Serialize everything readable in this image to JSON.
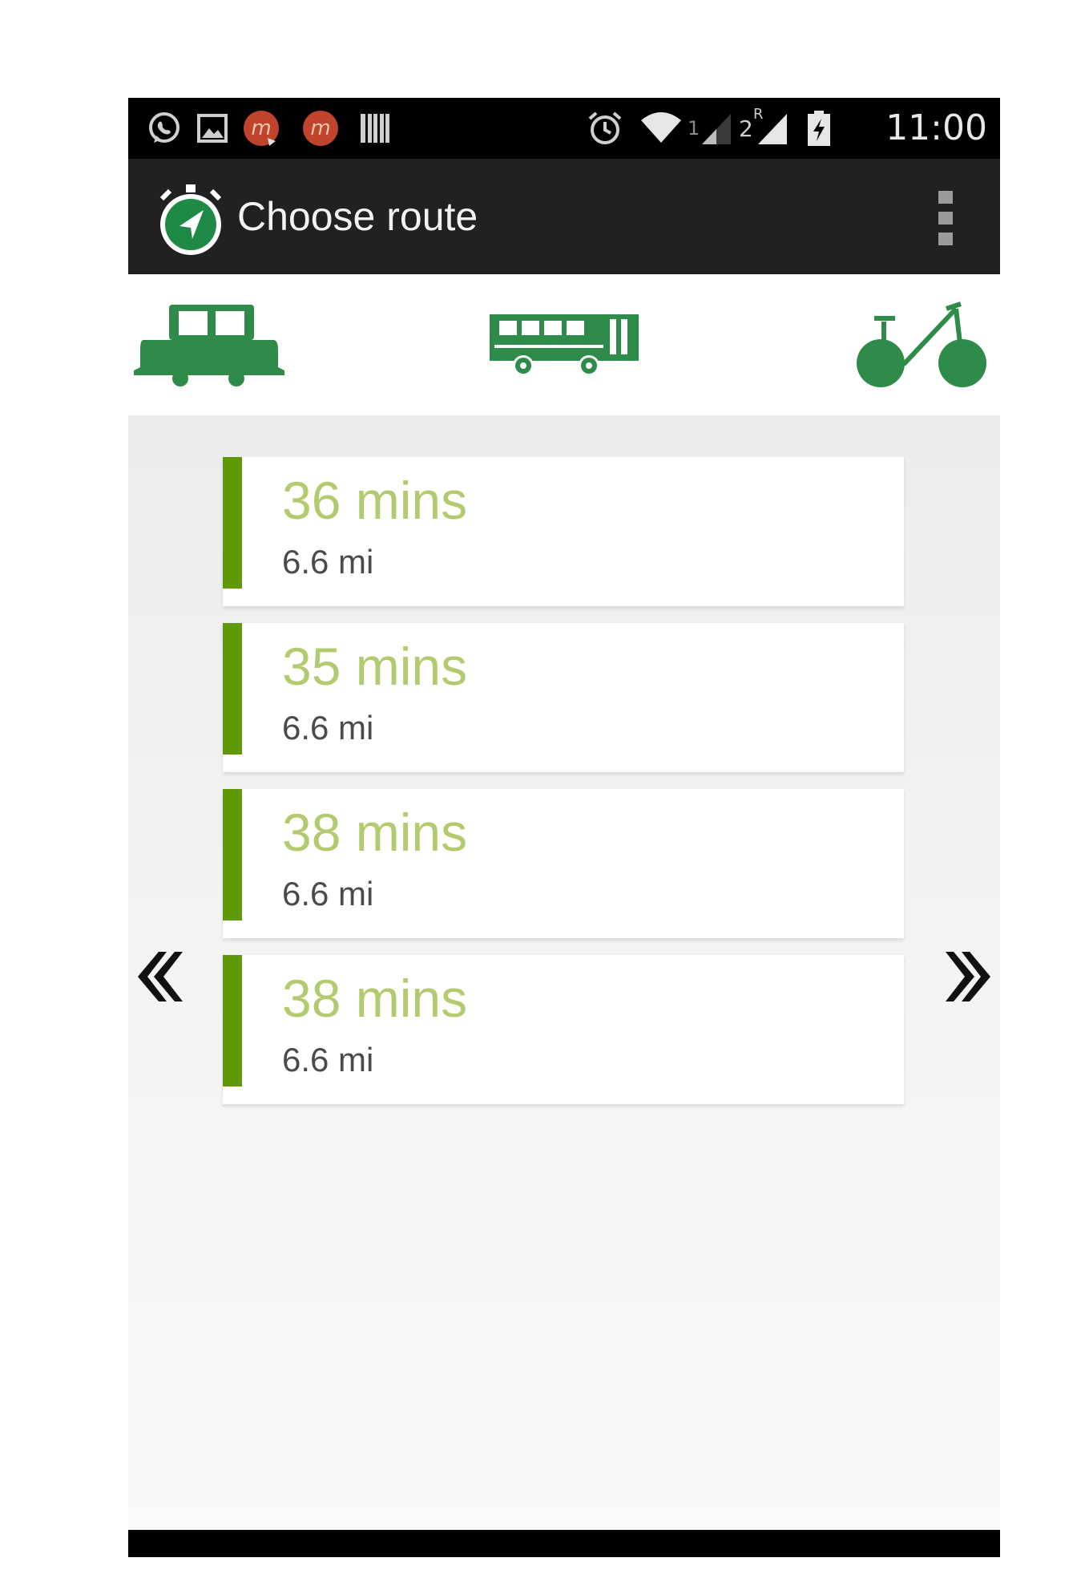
{
  "status_bar": {
    "time": "11:00",
    "sim1_label": "1",
    "sim2_label": "2",
    "roaming_label": "R",
    "left_icons": [
      "whatsapp-icon",
      "image-icon",
      "app-m-icon",
      "app-m-icon",
      "barcode-icon"
    ],
    "right_icons": [
      "alarm-icon",
      "wifi-icon",
      "signal-icon",
      "signal-icon",
      "battery-charging-icon"
    ]
  },
  "action_bar": {
    "title": "Choose route",
    "app_icon": "stopwatch-navigation-icon",
    "menu_icon": "overflow-menu-icon"
  },
  "modes": [
    {
      "name": "car",
      "icon": "car-icon"
    },
    {
      "name": "bus",
      "icon": "bus-icon"
    },
    {
      "name": "bike",
      "icon": "bicycle-icon"
    }
  ],
  "routes": [
    {
      "time": "36 mins",
      "distance": "6.6 mi"
    },
    {
      "time": "35 mins",
      "distance": "6.6 mi"
    },
    {
      "time": "38 mins",
      "distance": "6.6 mi"
    },
    {
      "time": "38 mins",
      "distance": "6.6 mi"
    }
  ],
  "navigation": {
    "prev_icon": "double-chevron-left-icon",
    "next_icon": "double-chevron-right-icon"
  },
  "colors": {
    "brand_green": "#1f8a45",
    "mode_green": "#2e8b4a",
    "accent_green": "#5f9a06",
    "time_text": "#b3ca6e",
    "action_bar": "#212121"
  }
}
